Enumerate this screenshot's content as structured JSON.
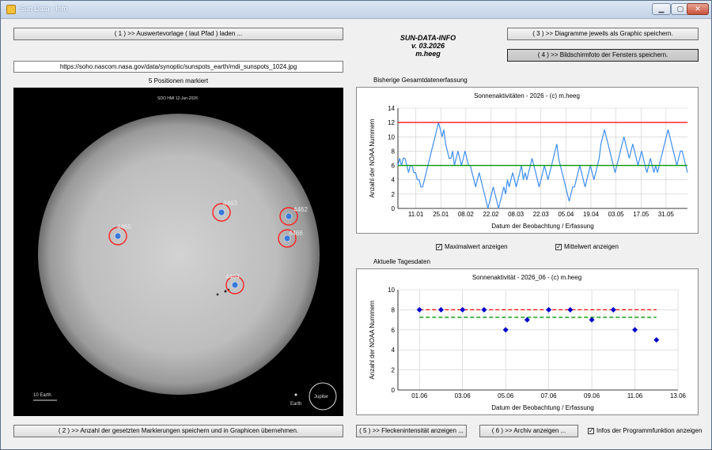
{
  "window": {
    "title": "Sun Data - Info",
    "buttons": [
      "minimize-icon",
      "maximize-icon",
      "close-icon"
    ]
  },
  "header": {
    "line1": "SUN-DATA-INFO",
    "line2": "v. 03.2026",
    "line3": "m.heeg"
  },
  "buttons": {
    "load_template": "( 1 ) >> Auswertevorlage ( laut Pfad ) laden ...",
    "save_marks": "( 2 ) >> Anzahl der gesetzten Markierungen speichern und in Graphicen übernehmen.",
    "save_graphics": "( 3 ) >> Diagramme jeweils als Graphic speichern.",
    "screenshot": "( 4 ) >> Bildschirmfoto der Fensters speichern.",
    "spot_intensity": "( 5 ) >> Fleckenintensität anzeigen ...",
    "archive": "( 6 ) >> Archiv anzeigen ..."
  },
  "url": "https://soho.nascom.nasa.gov/data/synoptic/sunspots_earth/mdi_sunspots_1024.jpg",
  "positions_label": "5 Positionen markiert",
  "sun_image": {
    "header_text": "SDO HMI   12-Jun-2026",
    "scale_label": "10 Earth",
    "earth_label": "Earth",
    "jupiter_label": "Jupiter",
    "markers": [
      {
        "id": "4462",
        "label": "4462"
      },
      {
        "id": "4463",
        "label": "4463"
      },
      {
        "id": "4464",
        "label": "4464"
      },
      {
        "id": "4465",
        "label": "4465"
      },
      {
        "id": "4466",
        "label": "4466"
      }
    ]
  },
  "section_total": "Bisherige Gesamtdatenerfassung",
  "section_daily": "Aktuelle Tagesdaten",
  "checkboxes": {
    "max": {
      "label": "Maximalwert anzeigen",
      "checked": true
    },
    "mean": {
      "label": "Mittelwert anzeigen",
      "checked": true
    },
    "info": {
      "label": "Infos der Programmfunktion anzeigen",
      "checked": true
    }
  },
  "colors": {
    "max_line": "#ff0000",
    "mean_line": "#009900",
    "series_line": "#3d8ef0",
    "points": "#0000cc",
    "marker_ring": "#ff2020",
    "marker_dot": "#3a78d8"
  },
  "chart_data": [
    {
      "type": "line",
      "title": "Sonnenaktivitäten - 2026 - (c) m.heeg",
      "xlabel": "Datum der Beobachtung / Erfassung",
      "ylabel": "Anzahl der NOAA Nummern",
      "ylim": [
        0,
        14
      ],
      "yticks": [
        0,
        2,
        4,
        6,
        8,
        10,
        12,
        14
      ],
      "xticks": [
        "11.01",
        "25.01",
        "08.02",
        "22.02",
        "08.03",
        "22.03",
        "05.04",
        "19.04",
        "03.05",
        "17.05",
        "31.05"
      ],
      "x_start": "2026-01-01",
      "x_end": "2026-06-12",
      "grid": true,
      "series": [
        {
          "values": [
            6,
            7,
            6,
            7,
            7,
            6,
            5,
            6,
            6,
            5,
            5,
            4,
            4,
            3,
            3,
            4,
            5,
            6,
            7,
            8,
            9,
            10,
            11,
            12,
            11,
            10,
            11,
            9,
            8,
            7,
            7,
            8,
            6,
            7,
            8,
            7,
            6,
            7,
            8,
            7,
            6,
            6,
            5,
            4,
            3,
            4,
            5,
            4,
            3,
            2,
            1,
            0,
            1,
            2,
            3,
            2,
            1,
            0,
            1,
            2,
            3,
            2,
            4,
            3,
            4,
            5,
            4,
            3,
            4,
            5,
            6,
            4,
            5,
            4,
            5,
            6,
            7,
            6,
            5,
            4,
            3,
            4,
            5,
            6,
            5,
            4,
            5,
            6,
            7,
            8,
            9,
            7,
            6,
            5,
            4,
            3,
            2,
            1,
            2,
            3,
            3,
            4,
            5,
            6,
            5,
            4,
            3,
            4,
            5,
            6,
            5,
            4,
            5,
            6,
            7,
            9,
            10,
            11,
            10,
            9,
            8,
            7,
            6,
            5,
            6,
            7,
            8,
            9,
            10,
            9,
            8,
            7,
            8,
            9,
            8,
            7,
            6,
            7,
            8,
            7,
            6,
            5,
            6,
            7,
            6,
            5,
            6,
            5,
            6,
            7,
            8,
            9,
            10,
            11,
            10,
            9,
            8,
            7,
            6,
            7,
            8,
            8,
            7,
            6,
            5
          ]
        }
      ],
      "max_value": 12,
      "mean_value": 6
    },
    {
      "type": "scatter",
      "title": "Sonnenaktivität - 2026_06 - (c) m.heeg",
      "xlabel": "Datum der Beobachtung / Erfassung",
      "ylabel": "Anzahl der NOAA Nummern",
      "ylim": [
        0,
        10
      ],
      "yticks": [
        0,
        2,
        4,
        6,
        8,
        10
      ],
      "xticks": [
        "01.06",
        "03.06",
        "05.06",
        "07.06",
        "09.06",
        "11.06",
        "13.06"
      ],
      "x_start_day": 0,
      "x_end_day": 13,
      "grid": true,
      "series": [
        {
          "x": [
            "01.06",
            "02.06",
            "03.06",
            "04.06",
            "05.06",
            "06.06",
            "07.06",
            "08.06",
            "09.06",
            "10.06",
            "11.06",
            "12.06"
          ],
          "values": [
            8,
            8,
            8,
            8,
            6,
            7,
            8,
            8,
            7,
            8,
            6,
            5
          ]
        }
      ],
      "max_value": 8,
      "mean_value": 7.25
    }
  ]
}
